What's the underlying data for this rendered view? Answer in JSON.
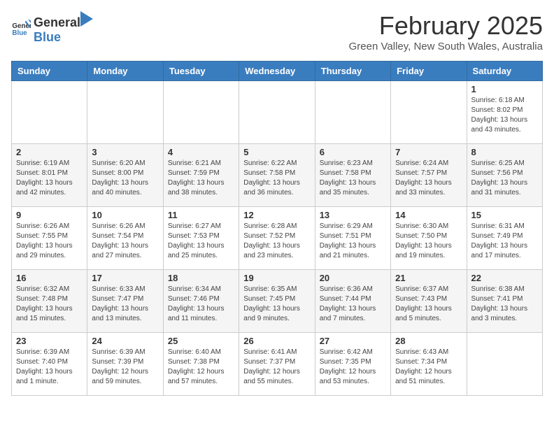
{
  "header": {
    "logo_general": "General",
    "logo_blue": "Blue",
    "month_title": "February 2025",
    "location": "Green Valley, New South Wales, Australia"
  },
  "days_of_week": [
    "Sunday",
    "Monday",
    "Tuesday",
    "Wednesday",
    "Thursday",
    "Friday",
    "Saturday"
  ],
  "weeks": [
    [
      {
        "day": "",
        "info": ""
      },
      {
        "day": "",
        "info": ""
      },
      {
        "day": "",
        "info": ""
      },
      {
        "day": "",
        "info": ""
      },
      {
        "day": "",
        "info": ""
      },
      {
        "day": "",
        "info": ""
      },
      {
        "day": "1",
        "info": "Sunrise: 6:18 AM\nSunset: 8:02 PM\nDaylight: 13 hours\nand 43 minutes."
      }
    ],
    [
      {
        "day": "2",
        "info": "Sunrise: 6:19 AM\nSunset: 8:01 PM\nDaylight: 13 hours\nand 42 minutes."
      },
      {
        "day": "3",
        "info": "Sunrise: 6:20 AM\nSunset: 8:00 PM\nDaylight: 13 hours\nand 40 minutes."
      },
      {
        "day": "4",
        "info": "Sunrise: 6:21 AM\nSunset: 7:59 PM\nDaylight: 13 hours\nand 38 minutes."
      },
      {
        "day": "5",
        "info": "Sunrise: 6:22 AM\nSunset: 7:58 PM\nDaylight: 13 hours\nand 36 minutes."
      },
      {
        "day": "6",
        "info": "Sunrise: 6:23 AM\nSunset: 7:58 PM\nDaylight: 13 hours\nand 35 minutes."
      },
      {
        "day": "7",
        "info": "Sunrise: 6:24 AM\nSunset: 7:57 PM\nDaylight: 13 hours\nand 33 minutes."
      },
      {
        "day": "8",
        "info": "Sunrise: 6:25 AM\nSunset: 7:56 PM\nDaylight: 13 hours\nand 31 minutes."
      }
    ],
    [
      {
        "day": "9",
        "info": "Sunrise: 6:26 AM\nSunset: 7:55 PM\nDaylight: 13 hours\nand 29 minutes."
      },
      {
        "day": "10",
        "info": "Sunrise: 6:26 AM\nSunset: 7:54 PM\nDaylight: 13 hours\nand 27 minutes."
      },
      {
        "day": "11",
        "info": "Sunrise: 6:27 AM\nSunset: 7:53 PM\nDaylight: 13 hours\nand 25 minutes."
      },
      {
        "day": "12",
        "info": "Sunrise: 6:28 AM\nSunset: 7:52 PM\nDaylight: 13 hours\nand 23 minutes."
      },
      {
        "day": "13",
        "info": "Sunrise: 6:29 AM\nSunset: 7:51 PM\nDaylight: 13 hours\nand 21 minutes."
      },
      {
        "day": "14",
        "info": "Sunrise: 6:30 AM\nSunset: 7:50 PM\nDaylight: 13 hours\nand 19 minutes."
      },
      {
        "day": "15",
        "info": "Sunrise: 6:31 AM\nSunset: 7:49 PM\nDaylight: 13 hours\nand 17 minutes."
      }
    ],
    [
      {
        "day": "16",
        "info": "Sunrise: 6:32 AM\nSunset: 7:48 PM\nDaylight: 13 hours\nand 15 minutes."
      },
      {
        "day": "17",
        "info": "Sunrise: 6:33 AM\nSunset: 7:47 PM\nDaylight: 13 hours\nand 13 minutes."
      },
      {
        "day": "18",
        "info": "Sunrise: 6:34 AM\nSunset: 7:46 PM\nDaylight: 13 hours\nand 11 minutes."
      },
      {
        "day": "19",
        "info": "Sunrise: 6:35 AM\nSunset: 7:45 PM\nDaylight: 13 hours\nand 9 minutes."
      },
      {
        "day": "20",
        "info": "Sunrise: 6:36 AM\nSunset: 7:44 PM\nDaylight: 13 hours\nand 7 minutes."
      },
      {
        "day": "21",
        "info": "Sunrise: 6:37 AM\nSunset: 7:43 PM\nDaylight: 13 hours\nand 5 minutes."
      },
      {
        "day": "22",
        "info": "Sunrise: 6:38 AM\nSunset: 7:41 PM\nDaylight: 13 hours\nand 3 minutes."
      }
    ],
    [
      {
        "day": "23",
        "info": "Sunrise: 6:39 AM\nSunset: 7:40 PM\nDaylight: 13 hours\nand 1 minute."
      },
      {
        "day": "24",
        "info": "Sunrise: 6:39 AM\nSunset: 7:39 PM\nDaylight: 12 hours\nand 59 minutes."
      },
      {
        "day": "25",
        "info": "Sunrise: 6:40 AM\nSunset: 7:38 PM\nDaylight: 12 hours\nand 57 minutes."
      },
      {
        "day": "26",
        "info": "Sunrise: 6:41 AM\nSunset: 7:37 PM\nDaylight: 12 hours\nand 55 minutes."
      },
      {
        "day": "27",
        "info": "Sunrise: 6:42 AM\nSunset: 7:35 PM\nDaylight: 12 hours\nand 53 minutes."
      },
      {
        "day": "28",
        "info": "Sunrise: 6:43 AM\nSunset: 7:34 PM\nDaylight: 12 hours\nand 51 minutes."
      },
      {
        "day": "",
        "info": ""
      }
    ]
  ]
}
